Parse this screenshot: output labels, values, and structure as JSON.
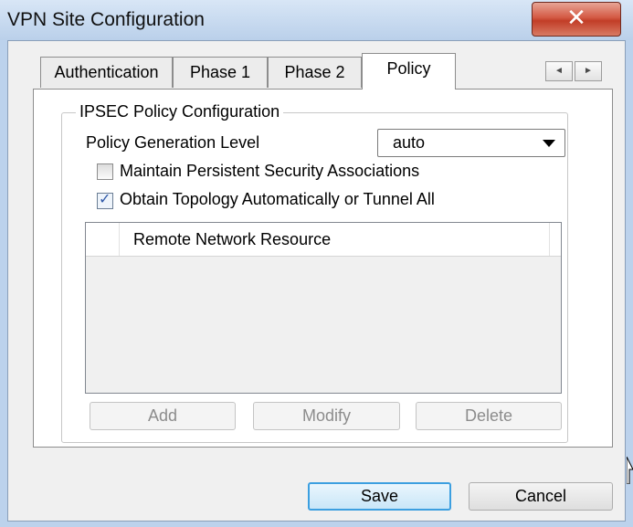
{
  "window": {
    "title": "VPN Site Configuration",
    "close_glyph": "✕"
  },
  "tabs": [
    {
      "label": "Authentication",
      "active": false
    },
    {
      "label": "Phase 1",
      "active": false
    },
    {
      "label": "Phase 2",
      "active": false
    },
    {
      "label": "Policy",
      "active": true
    }
  ],
  "tab_scroll": {
    "left": "◄",
    "right": "►"
  },
  "group": {
    "title": "IPSEC Policy Configuration",
    "policy_level_label": "Policy Generation Level",
    "policy_level_value": "auto",
    "persistent_sa": {
      "label": "Maintain Persistent Security Associations",
      "checked": false
    },
    "obtain_topology": {
      "label": "Obtain Topology Automatically or Tunnel All",
      "checked": true,
      "check_glyph": "✓"
    },
    "list": {
      "column_header": "Remote Network Resource",
      "rows": []
    },
    "buttons": {
      "add": "Add",
      "modify": "Modify",
      "delete": "Delete"
    }
  },
  "footer": {
    "save": "Save",
    "cancel": "Cancel"
  }
}
